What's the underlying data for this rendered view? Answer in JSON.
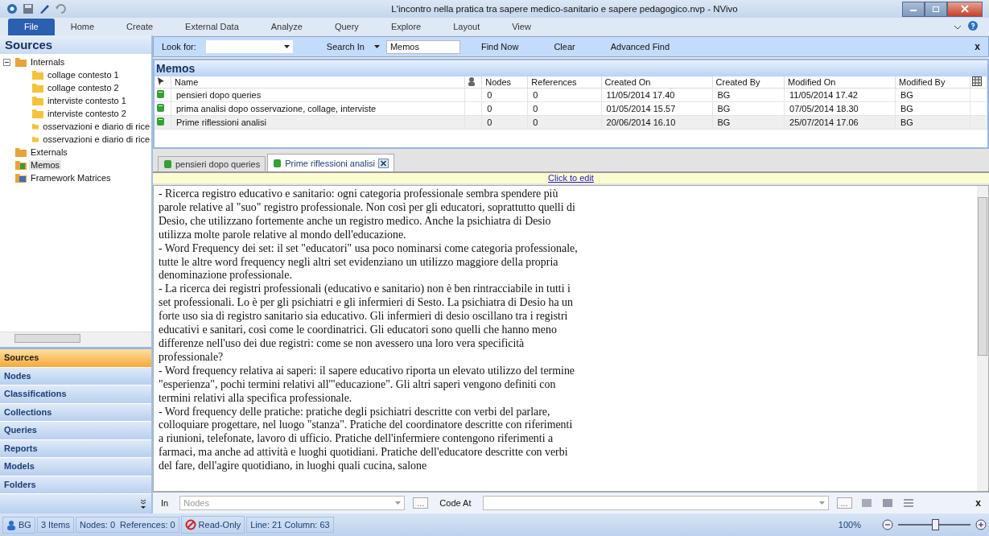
{
  "window": {
    "title": "L'incontro nella pratica tra sapere medico-sanitario e sapere pedagogico.nvp - NVivo"
  },
  "ribbon_tabs": [
    {
      "label": "File",
      "selected": true
    },
    {
      "label": "Home",
      "selected": false
    },
    {
      "label": "Create",
      "selected": false
    },
    {
      "label": "External Data",
      "selected": false
    },
    {
      "label": "Analyze",
      "selected": false
    },
    {
      "label": "Query",
      "selected": false
    },
    {
      "label": "Explore",
      "selected": false
    },
    {
      "label": "Layout",
      "selected": false
    },
    {
      "label": "View",
      "selected": false
    }
  ],
  "sidebar": {
    "title": "Sources",
    "tree": [
      {
        "label": "Internals",
        "kind": "internals",
        "expanded": true,
        "selected": false,
        "children": [
          {
            "label": "collage contesto 1",
            "kind": "folder",
            "selected": false
          },
          {
            "label": "collage contesto 2",
            "kind": "folder",
            "selected": false
          },
          {
            "label": "interviste contesto 1",
            "kind": "folder",
            "selected": false
          },
          {
            "label": "interviste contesto 2",
            "kind": "folder",
            "selected": false
          },
          {
            "label": "osservazioni e diario di rice",
            "kind": "folder",
            "selected": false
          },
          {
            "label": "osservazioni e diario di rice",
            "kind": "folder",
            "selected": false
          }
        ]
      },
      {
        "label": "Externals",
        "kind": "externals",
        "selected": false
      },
      {
        "label": "Memos",
        "kind": "memos",
        "selected": true
      },
      {
        "label": "Framework Matrices",
        "kind": "matrices",
        "selected": false
      }
    ],
    "nav": [
      {
        "label": "Sources",
        "selected": true
      },
      {
        "label": "Nodes",
        "selected": false
      },
      {
        "label": "Classifications",
        "selected": false
      },
      {
        "label": "Collections",
        "selected": false
      },
      {
        "label": "Queries",
        "selected": false
      },
      {
        "label": "Reports",
        "selected": false
      },
      {
        "label": "Models",
        "selected": false
      },
      {
        "label": "Folders",
        "selected": false
      }
    ]
  },
  "find_bar": {
    "look_for_label": "Look for:",
    "search_in_label": "Search In",
    "search_in_value": "Memos",
    "find_now": "Find Now",
    "clear": "Clear",
    "advanced_find": "Advanced Find",
    "close": "x"
  },
  "list": {
    "title": "Memos",
    "columns": [
      "Name",
      "Nodes",
      "References",
      "Created On",
      "Created By",
      "Modified On",
      "Modified By"
    ],
    "rows": [
      {
        "cells": [
          "pensieri dopo queries",
          "0",
          "0",
          "11/05/2014 17.40",
          "BG",
          "11/05/2014 17.42",
          "BG"
        ],
        "selected": false
      },
      {
        "cells": [
          "prima analisi dopo osservazione, collage, interviste",
          "0",
          "0",
          "01/05/2014 15.57",
          "BG",
          "07/05/2014 18.30",
          "BG"
        ],
        "selected": false
      },
      {
        "cells": [
          "Prime riflessioni analisi",
          "0",
          "0",
          "20/06/2014 16.10",
          "BG",
          "25/07/2014 17.06",
          "BG"
        ],
        "selected": true
      }
    ]
  },
  "doc_tabs": [
    {
      "label": "pensieri dopo queries",
      "selected": false
    },
    {
      "label": "Prime riflessioni analisi",
      "selected": true
    }
  ],
  "click_to_edit": "Click to edit",
  "memo_lines": [
    "- Ricerca registro educativo e sanitario: ogni categoria professionale sembra spendere più",
    "parole relative al \"suo\" registro professionale. Non così per gli educatori, soprattutto quelli di",
    "Desio, che utilizzano fortemente anche un registro medico. Anche la psichiatra di Desio",
    "utilizza molte parole relative al mondo dell'educazione.",
    "- Word Frequency dei set: il set \"educatori\" usa poco nominarsi come categoria professionale,",
    "tutte le altre word frequency negli altri set evidenziano un utilizzo maggiore della propria",
    "denominazione professionale.",
    "- La ricerca dei registri professionali (educativo e sanitario) non è ben rintracciabile in tutti i",
    "set professionali. Lo è per gli psichiatri e gli infermieri di Sesto. La psichiatra di Desio ha un",
    "forte uso sia di registro sanitario sia educativo. Gli infermieri di desio oscillano tra i registri",
    "educativi e sanitari, così come le coordinatrici. Gli educatori sono quelli che hanno meno",
    "differenze nell'uso dei due registri: come se non avessero una loro vera specificità",
    "professionale?",
    "- Word frequency relativa ai saperi: il sapere educativo riporta un elevato utilizzo del termine",
    "\"esperienza\", pochi termini relativi all'\"educazione\". Gli altri saperi vengono definiti con",
    "termini relativi alla specifica professionale.",
    "- Word frequency delle pratiche: pratiche degli psichiatri descritte con verbi del parlare,",
    "colloquiare progettare, nel luogo \"stanza\". Pratiche del coordinatore descritte con riferimenti",
    "a riunioni, telefonate, lavoro di ufficio. Pratiche dell'infermiere contengono riferimenti a",
    "farmaci, ma anche ad attività e luoghi quotidiani. Pratiche dell'educatore descritte con verbi",
    "del fare, dell'agire quotidiano, in luoghi quali cucina, salone"
  ],
  "coding_bar": {
    "in_label": "In",
    "in_value": "Nodes",
    "browse": "...",
    "code_at_label": "Code At",
    "browse2": "...",
    "close": "x"
  },
  "status_bar": {
    "user": "BG",
    "items": "3 Items",
    "counts": "Nodes: 0  References: 0",
    "readonly": "Read-Only",
    "position": "Line: 21 Column: 63",
    "zoom": "100%",
    "zoom_level": {
      "level": 0.5
    }
  }
}
